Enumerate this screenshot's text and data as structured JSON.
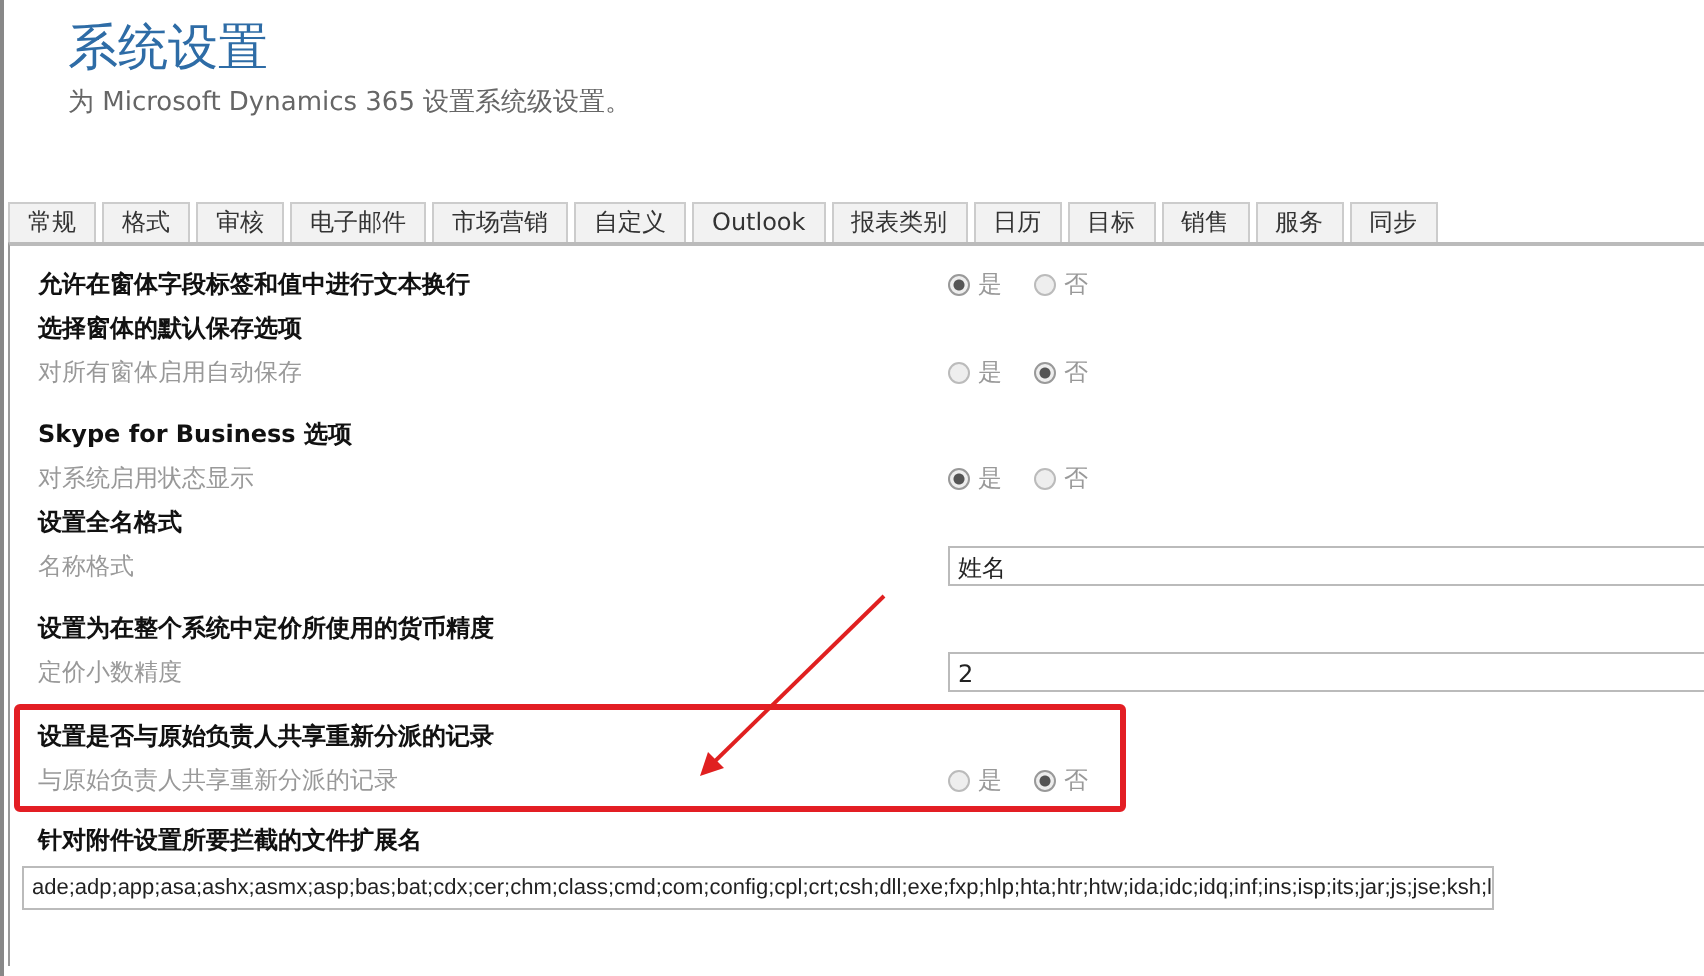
{
  "header": {
    "title": "系统设置",
    "subtitle": "为 Microsoft Dynamics 365 设置系统级设置。"
  },
  "tabs": [
    {
      "label": "常规"
    },
    {
      "label": "格式"
    },
    {
      "label": "审核"
    },
    {
      "label": "电子邮件"
    },
    {
      "label": "市场营销"
    },
    {
      "label": "自定义"
    },
    {
      "label": "Outlook"
    },
    {
      "label": "报表类别"
    },
    {
      "label": "日历"
    },
    {
      "label": "目标"
    },
    {
      "label": "销售"
    },
    {
      "label": "服务"
    },
    {
      "label": "同步"
    }
  ],
  "groups": [
    {
      "highlighted": false,
      "items": [
        {
          "kind": "radio",
          "label": "允许在窗体字段标签和值中进行文本换行",
          "bold": true,
          "options": [
            {
              "label": "是",
              "selected": true
            },
            {
              "label": "否",
              "selected": false
            }
          ]
        },
        {
          "kind": "heading",
          "label": "选择窗体的默认保存选项"
        },
        {
          "kind": "radio",
          "label": "对所有窗体启用自动保存",
          "bold": false,
          "options": [
            {
              "label": "是",
              "selected": false
            },
            {
              "label": "否",
              "selected": true
            }
          ]
        }
      ]
    },
    {
      "highlighted": false,
      "items": [
        {
          "kind": "heading",
          "label": "Skype for Business 选项"
        },
        {
          "kind": "radio",
          "label": "对系统启用状态显示",
          "bold": false,
          "options": [
            {
              "label": "是",
              "selected": true
            },
            {
              "label": "否",
              "selected": false
            }
          ]
        },
        {
          "kind": "heading",
          "label": "设置全名格式"
        },
        {
          "kind": "field",
          "label": "名称格式",
          "value": "姓名"
        }
      ]
    },
    {
      "highlighted": false,
      "items": [
        {
          "kind": "heading",
          "label": "设置为在整个系统中定价所使用的货币精度"
        },
        {
          "kind": "field",
          "label": "定价小数精度",
          "value": "2"
        }
      ]
    },
    {
      "highlighted": true,
      "items": [
        {
          "kind": "heading",
          "label": "设置是否与原始负责人共享重新分派的记录"
        },
        {
          "kind": "radio",
          "label": "与原始负责人共享重新分派的记录",
          "bold": false,
          "options": [
            {
              "label": "是",
              "selected": false
            },
            {
              "label": "否",
              "selected": true
            }
          ]
        }
      ]
    },
    {
      "highlighted": false,
      "items": [
        {
          "kind": "heading",
          "label": "针对附件设置所要拦截的文件扩展名"
        },
        {
          "kind": "wide-field",
          "value": "ade;adp;app;asa;ashx;asmx;asp;bas;bat;cdx;cer;chm;class;cmd;com;config;cpl;crt;csh;dll;exe;fxp;hlp;hta;htr;htw;ida;idc;idq;inf;ins;isp;its;jar;js;jse;ksh;l"
        }
      ]
    }
  ]
}
